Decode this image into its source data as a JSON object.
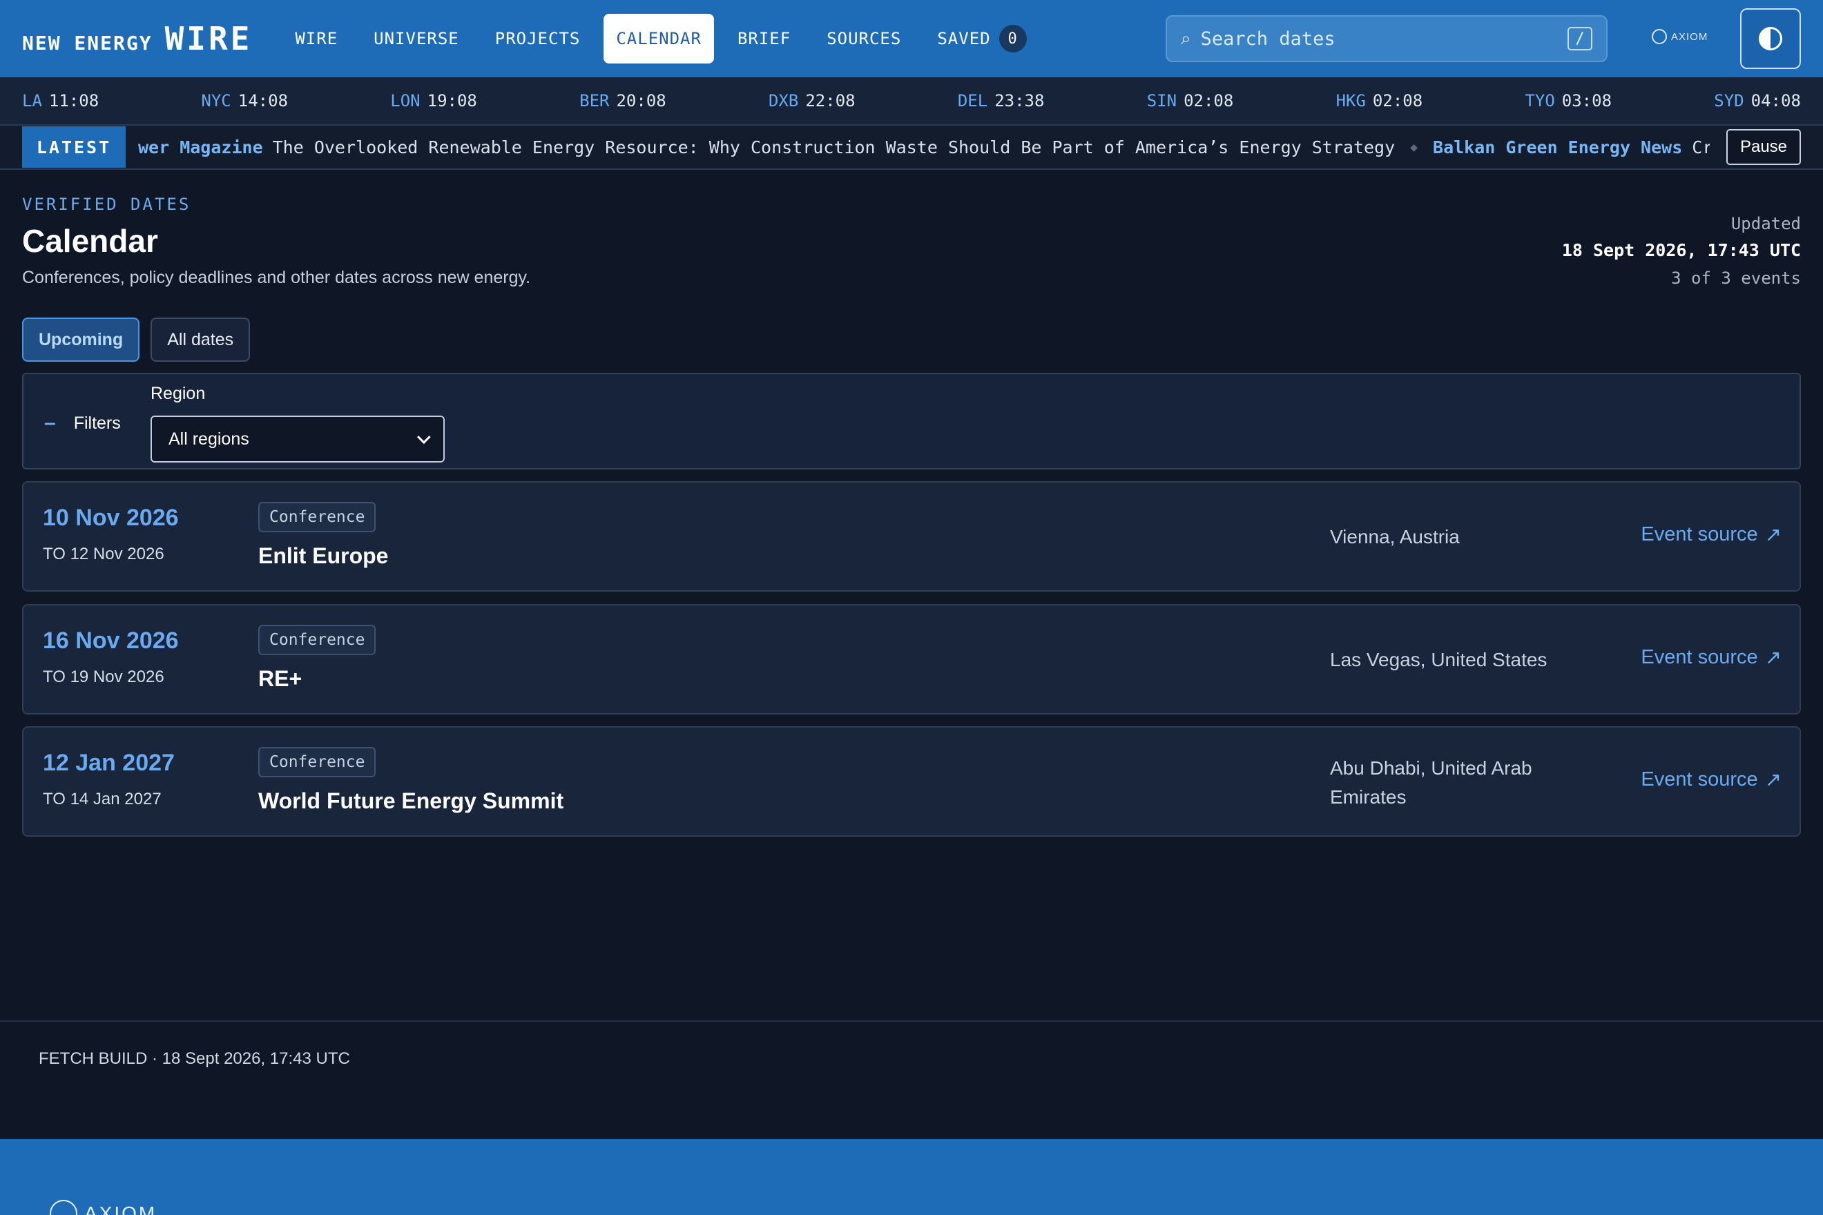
{
  "brand": {
    "small": "NEW ENERGY",
    "big": "WIRE"
  },
  "nav": [
    {
      "label": "WIRE",
      "active": false
    },
    {
      "label": "UNIVERSE",
      "active": false
    },
    {
      "label": "PROJECTS",
      "active": false
    },
    {
      "label": "CALENDAR",
      "active": true
    },
    {
      "label": "BRIEF",
      "active": false
    },
    {
      "label": "SOURCES",
      "active": false
    },
    {
      "label": "SAVED",
      "active": false,
      "count": "0"
    }
  ],
  "search": {
    "placeholder": "Search dates",
    "shortcut": "/",
    "icon": "search-icon"
  },
  "axiom_logo": "AXIOM",
  "clocks": [
    {
      "city": "LA",
      "time": "11:08"
    },
    {
      "city": "NYC",
      "time": "14:08"
    },
    {
      "city": "LON",
      "time": "19:08"
    },
    {
      "city": "BER",
      "time": "20:08"
    },
    {
      "city": "DXB",
      "time": "22:08"
    },
    {
      "city": "DEL",
      "time": "23:38"
    },
    {
      "city": "SIN",
      "time": "02:08"
    },
    {
      "city": "HKG",
      "time": "02:08"
    },
    {
      "city": "TYO",
      "time": "03:08"
    },
    {
      "city": "SYD",
      "time": "04:08"
    }
  ],
  "ticker": {
    "label": "LATEST",
    "items": [
      {
        "source": "wer Magazine",
        "headline": "The Overlooked Renewable Energy Resource: Why Construction Waste Should Be Part of America’s Energy Strategy"
      },
      {
        "source": "Balkan Green Energy News",
        "headline": "Croatia"
      }
    ],
    "pause_label": "Pause"
  },
  "page": {
    "eyebrow": "VERIFIED DATES",
    "title": "Calendar",
    "subtitle": "Conferences, policy deadlines and other dates across new energy.",
    "updated_label": "Updated",
    "updated_value": "18 Sept 2026, 17:43 UTC",
    "count_text": "3 of 3 events"
  },
  "tabs": [
    {
      "label": "Upcoming",
      "active": true
    },
    {
      "label": "All dates",
      "active": false
    }
  ],
  "filters": {
    "toggle_label": "Filters",
    "region_label": "Region",
    "region_value": "All regions"
  },
  "events": [
    {
      "date": "10 Nov 2026",
      "to": "TO 12 Nov 2026",
      "tag": "Conference",
      "title": "Enlit Europe",
      "location": "Vienna, Austria",
      "link": "Event source"
    },
    {
      "date": "16 Nov 2026",
      "to": "TO 19 Nov 2026",
      "tag": "Conference",
      "title": "RE+",
      "location": "Las Vegas, United States",
      "link": "Event source"
    },
    {
      "date": "12 Jan 2027",
      "to": "TO 14 Jan 2027",
      "tag": "Conference",
      "title": "World Future Energy Summit",
      "location": "Abu Dhabi, United Arab Emirates",
      "link": "Event source"
    }
  ],
  "footer": {
    "build": "FETCH BUILD · 18 Sept 2026, 17:43 UTC"
  },
  "colors": {
    "accent": "#1e6bb8",
    "link": "#6aaaf0",
    "background": "#0f1726"
  }
}
